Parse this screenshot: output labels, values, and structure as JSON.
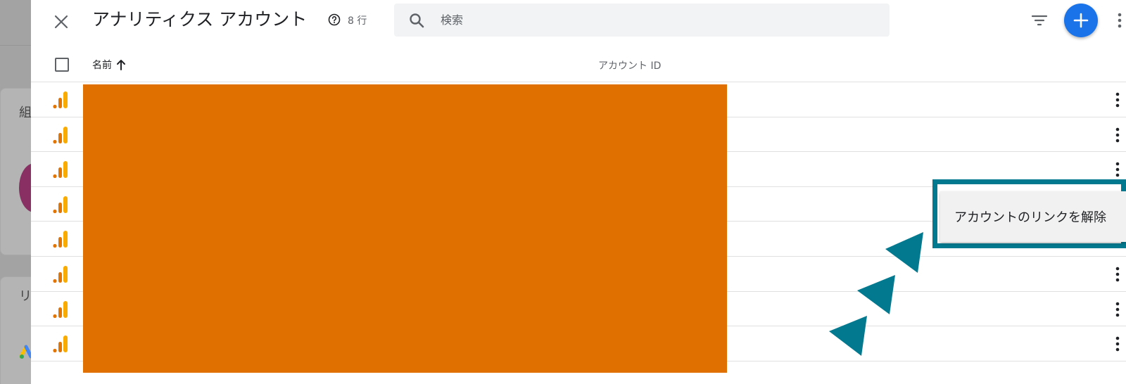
{
  "header": {
    "title": "アナリティクス アカウント",
    "row_count": "8 行",
    "search_placeholder": "検索"
  },
  "table": {
    "columns": [
      "名前",
      "アカウント ID"
    ],
    "row_count": 8
  },
  "context_menu": {
    "unlink_label": "アカウントのリンクを解除"
  },
  "background": {
    "text_1": "組",
    "text_2": "リ"
  },
  "colors": {
    "accent": "#1a73e8",
    "redaction": "#e07000",
    "highlight": "#03798f",
    "ga_orange": "#e37400",
    "ga_yellow": "#f9ab00"
  }
}
